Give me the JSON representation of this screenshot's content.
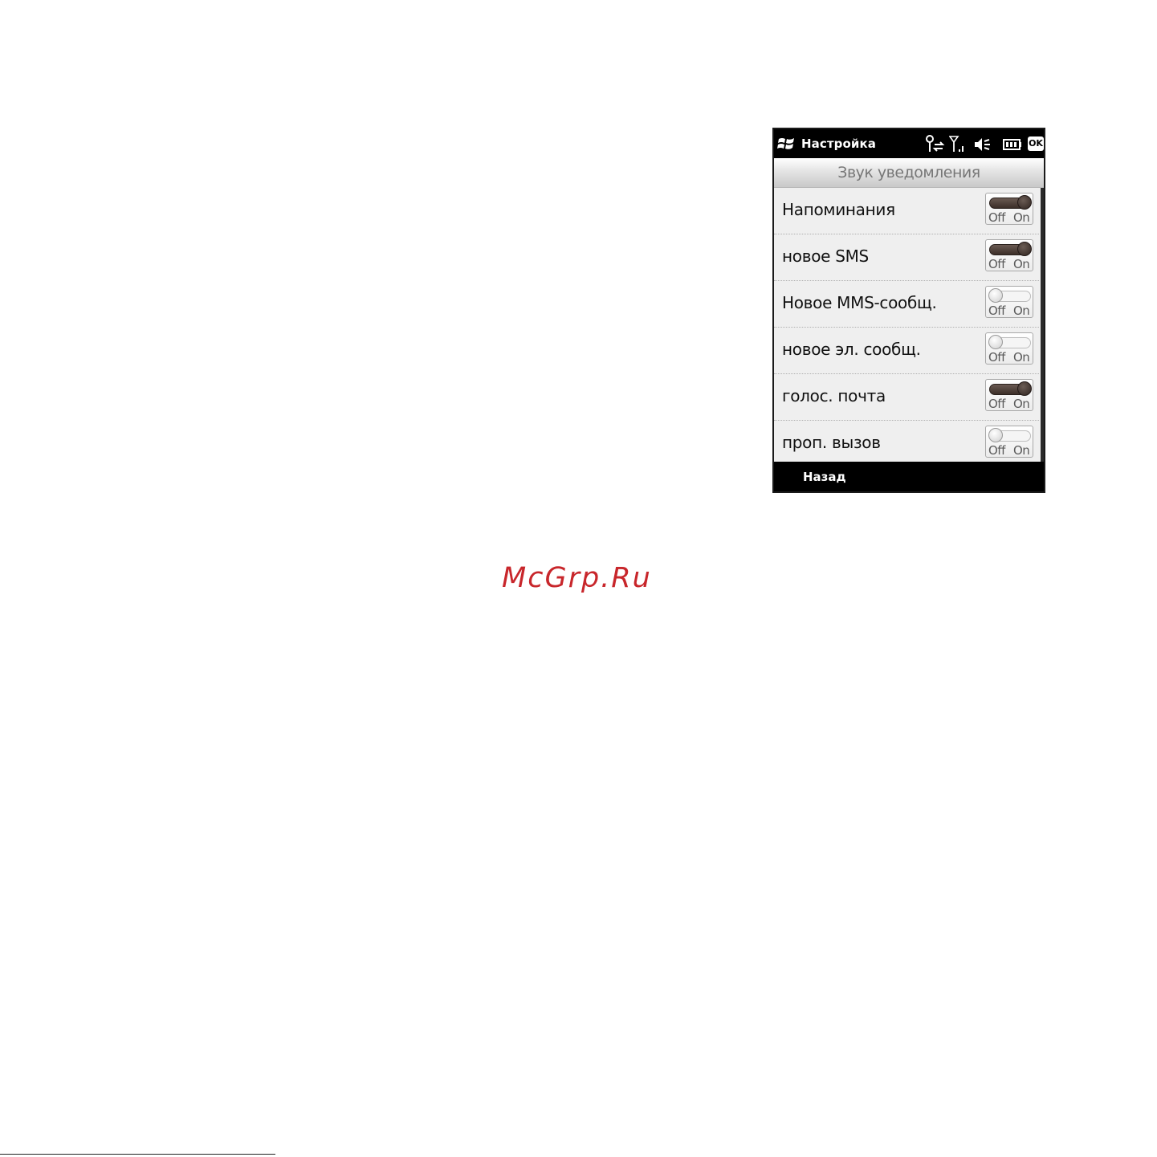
{
  "app": {
    "title": "Настройка",
    "ok_label": "OK",
    "section_header": "Звук уведомления",
    "back_label": "Назад"
  },
  "status_icons": [
    "connectivity-icon",
    "signal-strength-icon",
    "speaker-muted-icon",
    "battery-icon"
  ],
  "toggle_labels": {
    "off": "Off",
    "on": "On"
  },
  "items": [
    {
      "label": "Напоминания",
      "on": true
    },
    {
      "label": "новое SMS",
      "on": true
    },
    {
      "label": "Новое MMS-сообщ.",
      "on": false
    },
    {
      "label": "новое эл. сообщ.",
      "on": false
    },
    {
      "label": "голос. почта",
      "on": true
    },
    {
      "label": "проп. вызов",
      "on": false
    }
  ],
  "watermark": "McGrp.Ru",
  "colors": {
    "titlebar": "#000000",
    "toggle_on": "#3b2e28",
    "watermark": "#c8262b"
  }
}
